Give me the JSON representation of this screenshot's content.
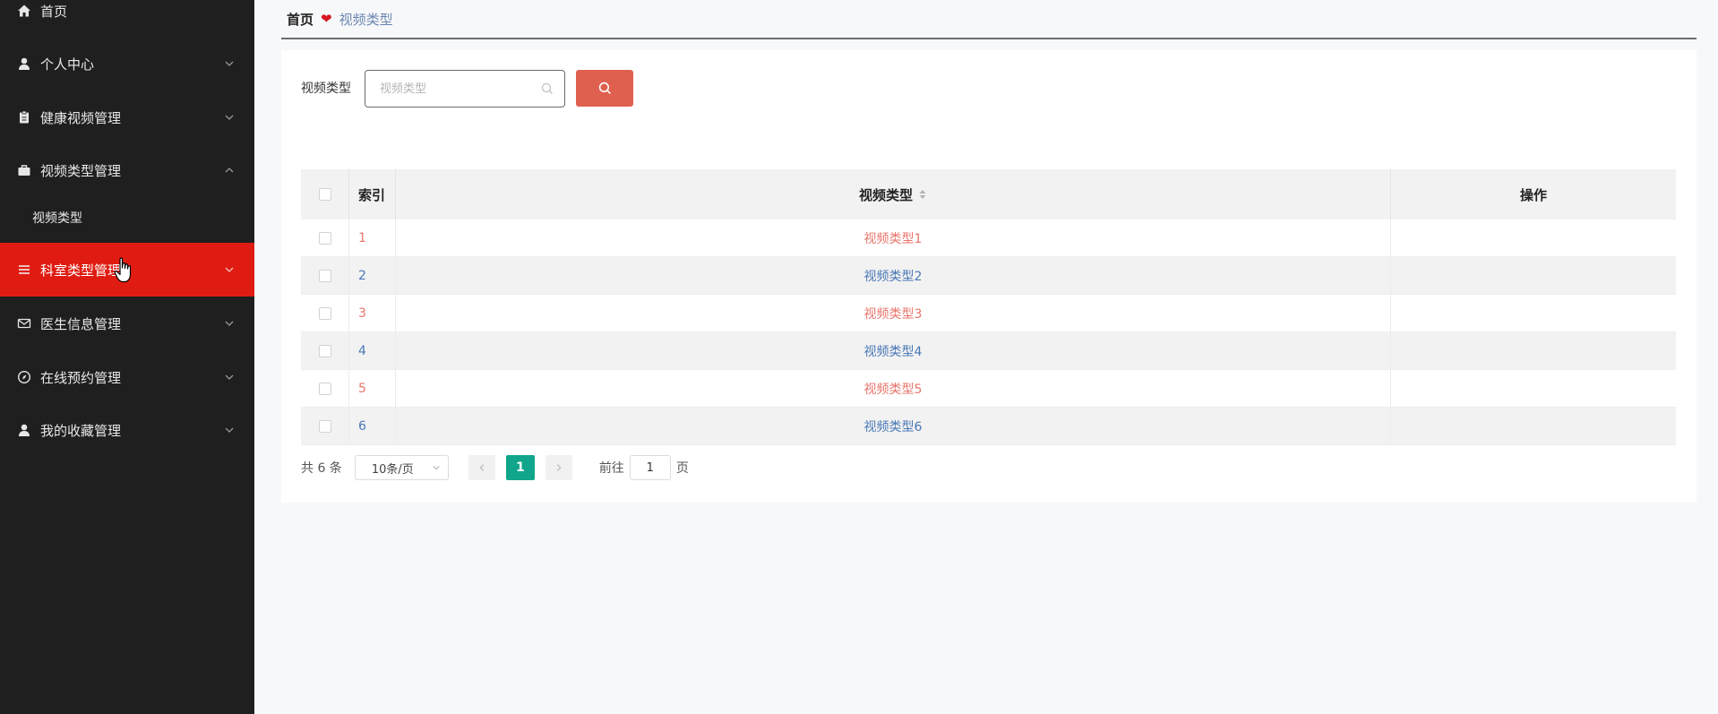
{
  "sidebar": {
    "items": [
      {
        "label": "首页",
        "icon": "home-icon"
      },
      {
        "label": "个人中心",
        "icon": "user-icon"
      },
      {
        "label": "健康视频管理",
        "icon": "clipboard-icon"
      },
      {
        "label": "视频类型管理",
        "icon": "briefcase-icon"
      },
      {
        "label": "科室类型管理",
        "icon": "menu-icon"
      },
      {
        "label": "医生信息管理",
        "icon": "mail-icon"
      },
      {
        "label": "在线预约管理",
        "icon": "compass-icon"
      },
      {
        "label": "我的收藏管理",
        "icon": "user-icon"
      }
    ],
    "sub_items": [
      {
        "label": "视频类型"
      }
    ],
    "active_color": "#e01c12",
    "background": "#1f1f1f"
  },
  "breadcrumb": {
    "home": "首页",
    "current": "视频类型"
  },
  "search": {
    "label": "视频类型",
    "placeholder": "视频类型",
    "button_icon": "search-icon",
    "button_color": "#e0604f"
  },
  "table": {
    "headers": {
      "index": "索引",
      "type": "视频类型",
      "actions": "操作"
    },
    "rows": [
      {
        "index": "1",
        "type": "视频类型1"
      },
      {
        "index": "2",
        "type": "视频类型2"
      },
      {
        "index": "3",
        "type": "视频类型3"
      },
      {
        "index": "4",
        "type": "视频类型4"
      },
      {
        "index": "5",
        "type": "视频类型5"
      },
      {
        "index": "6",
        "type": "视频类型6"
      }
    ]
  },
  "pagination": {
    "total": "共 6 条",
    "page_size": "10条/页",
    "current_page": "1",
    "goto_label": "前往",
    "goto_value": "1",
    "page_suffix": "页",
    "accent": "#11a58b"
  }
}
